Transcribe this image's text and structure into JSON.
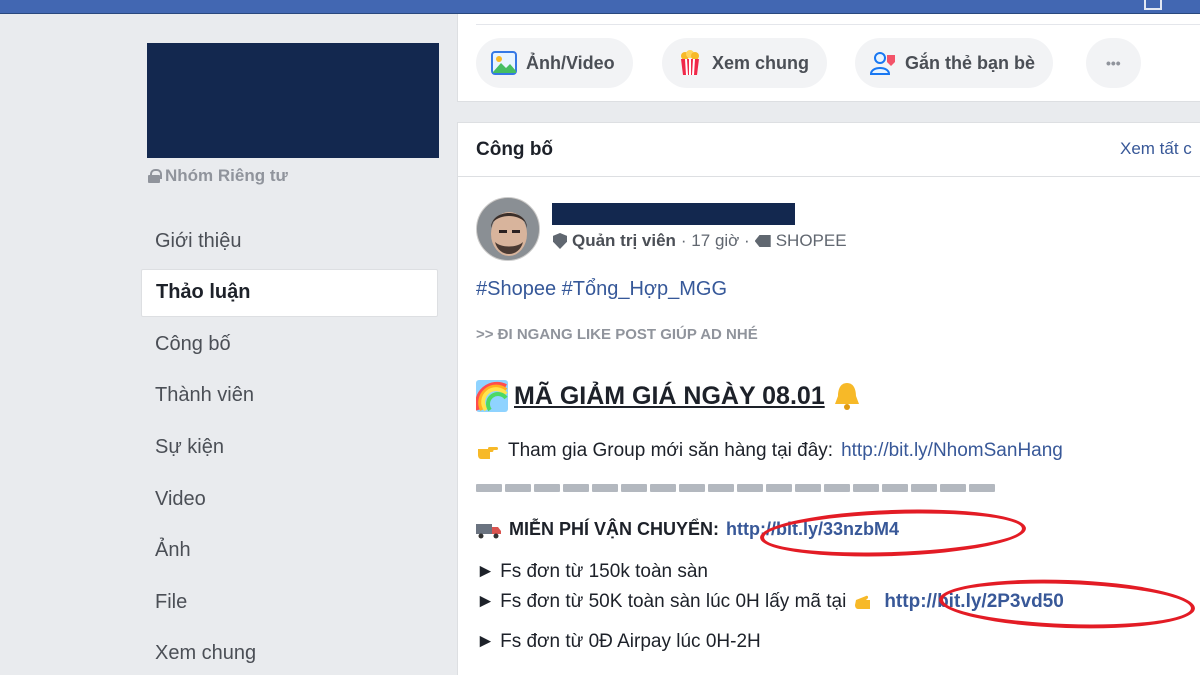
{
  "group": {
    "privacy_label": "Nhóm Riêng tư"
  },
  "sidebar": {
    "items": [
      {
        "label": "Giới thiệu",
        "active": false
      },
      {
        "label": "Thảo luận",
        "active": true
      },
      {
        "label": "Công bố",
        "active": false
      },
      {
        "label": "Thành viên",
        "active": false
      },
      {
        "label": "Sự kiện",
        "active": false
      },
      {
        "label": "Video",
        "active": false
      },
      {
        "label": "Ảnh",
        "active": false
      },
      {
        "label": "File",
        "active": false
      },
      {
        "label": "Xem chung",
        "active": false
      }
    ]
  },
  "composer": {
    "actions": [
      {
        "label": "Ảnh/Video",
        "icon": "photo-icon"
      },
      {
        "label": "Xem chung",
        "icon": "popcorn-icon"
      },
      {
        "label": "Gắn thẻ bạn bè",
        "icon": "tag-friends-icon"
      },
      {
        "label": "•••",
        "icon": "more-icon"
      }
    ]
  },
  "announcements": {
    "title": "Công bố",
    "see_all": "Xem tất c",
    "post": {
      "role": "Quản trị viên",
      "time": "· 17 giờ ·",
      "topic": "SHOPEE",
      "hashtags": "#Shopee #Tổng_Hợp_MGG",
      "notice": ">> ĐI NGANG LIKE POST GIÚP AD NHÉ",
      "headline": "MÃ GIẢM GIÁ NGÀY 08.01",
      "join_text": "Tham gia Group mới săn hàng tại đây:",
      "join_link": "http://bit.ly/NhomSanHang",
      "freeship_label": "MIỄN PHÍ VẬN CHUYỂN:",
      "freeship_link": "http://bit.ly/33nzbM4",
      "bullets": [
        {
          "text": "► Fs đơn từ 150k toàn sàn"
        },
        {
          "text": "► Fs đơn từ 50K toàn sàn lúc 0H lấy mã tại",
          "link": "http://bit.ly/2P3vd50"
        },
        {
          "text": "► Fs đơn từ 0Đ Airpay lúc 0H-2H"
        }
      ]
    }
  },
  "colors": {
    "topbar": "#4267b2",
    "cover_redaction": "#13284f",
    "link": "#385898",
    "highlight_circle": "#e31c25"
  }
}
